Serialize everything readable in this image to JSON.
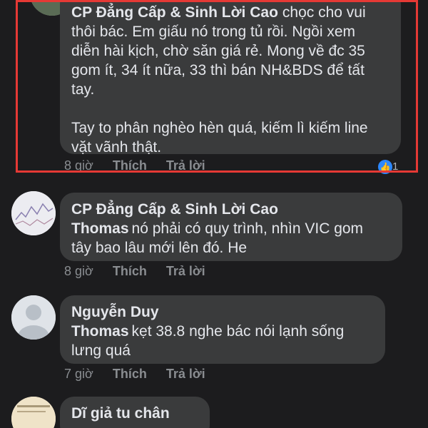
{
  "comments": [
    {
      "author": "CP Đẳng Cấp & Sinh Lời Cao",
      "lines": [
        "chọc cho vui",
        "thôi bác. Em giấu nó trong tủ rồi. Ngồi xem",
        "diễn hài kịch, chờ săn giá rẻ. Mong về đc 35",
        "gom ít, 34 ít nữa, 33 thì bán NH&BDS để tất",
        "tay.",
        "",
        "Tay to phân nghèo hèn quá, kiếm lì kiếm line",
        "vặt vãnh thật."
      ],
      "time": "8 giờ",
      "like_label": "Thích",
      "reply_label": "Trả lời",
      "like_count": "1"
    },
    {
      "author": "CP Đẳng Cấp & Sinh Lời Cao",
      "mention": "Thomas",
      "lines": [
        "nó phải có quy trình, nhìn VIC gom",
        "tây bao lâu mới lên đó. He"
      ],
      "time": "8 giờ",
      "like_label": "Thích",
      "reply_label": "Trả lời"
    },
    {
      "author": "Nguyễn  Duy",
      "mention": "Thomas",
      "lines": [
        "kẹt 38.8 nghe bác nói lạnh sống",
        "lưng quá"
      ],
      "time": "7 giờ",
      "like_label": "Thích",
      "reply_label": "Trả lời"
    },
    {
      "author": "Dĩ giả tu chân",
      "lines": []
    }
  ],
  "colors": {
    "background": "#1c1c1e",
    "bubble": "#3a3b3c",
    "highlight": "#e53935",
    "like_blue": "#2d88ff"
  }
}
